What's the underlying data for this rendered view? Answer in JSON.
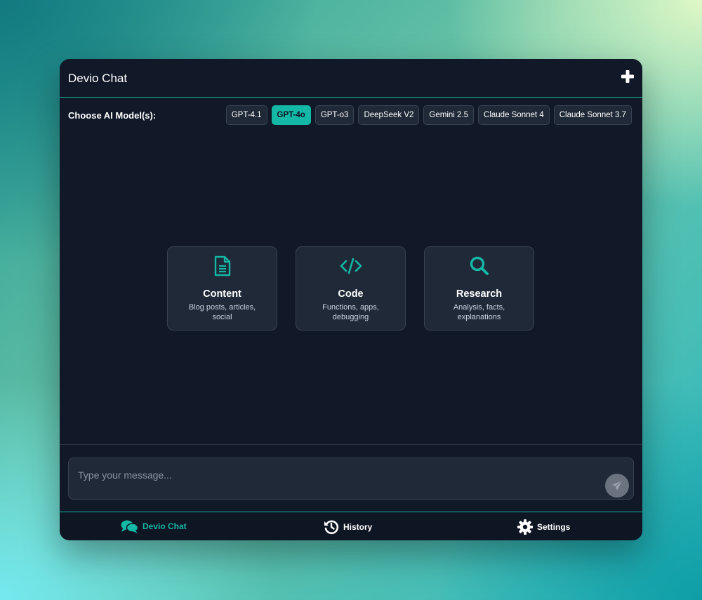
{
  "header": {
    "title": "Devio Chat",
    "new_chat_icon": "plus-icon"
  },
  "models": {
    "label": "Choose AI Model(s):",
    "options": [
      {
        "label": "GPT-4.1",
        "selected": false
      },
      {
        "label": "GPT-4o",
        "selected": true
      },
      {
        "label": "GPT-o3",
        "selected": false
      },
      {
        "label": "DeepSeek V2",
        "selected": false
      },
      {
        "label": "Gemini 2.5",
        "selected": false
      },
      {
        "label": "Claude Sonnet 4",
        "selected": false
      },
      {
        "label": "Claude Sonnet 3.7",
        "selected": false
      }
    ]
  },
  "cards": [
    {
      "title": "Content",
      "description": "Blog posts, articles, social",
      "icon": "document-icon"
    },
    {
      "title": "Code",
      "description": "Functions, apps, debugging",
      "icon": "code-icon"
    },
    {
      "title": "Research",
      "description": "Analysis, facts, explanations",
      "icon": "search-icon"
    }
  ],
  "composer": {
    "placeholder": "Type your message...",
    "send_icon": "paper-plane-icon"
  },
  "nav": {
    "items": [
      {
        "label": "Devio Chat",
        "icon": "chat-bubbles-icon",
        "active": true
      },
      {
        "label": "History",
        "icon": "history-icon",
        "active": false
      },
      {
        "label": "Settings",
        "icon": "gear-icon",
        "active": false
      }
    ]
  },
  "colors": {
    "accent": "#14b8a6",
    "panel": "#111827",
    "card": "#1f2937"
  }
}
